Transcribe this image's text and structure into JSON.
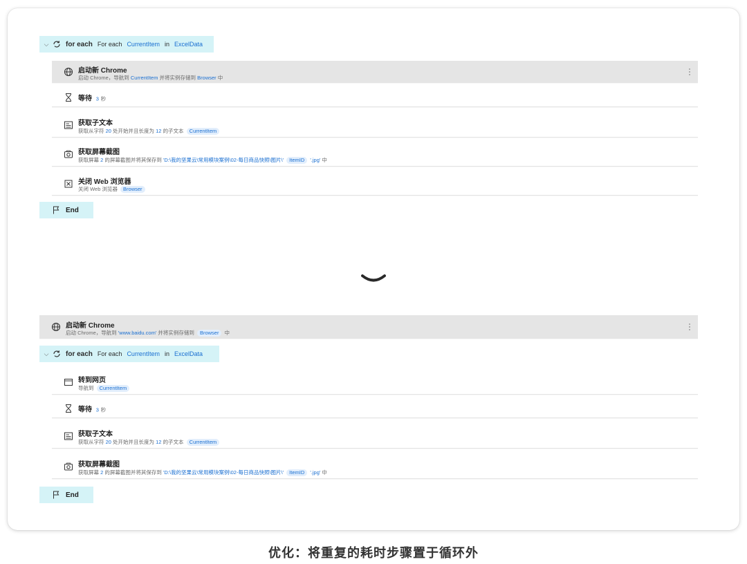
{
  "top": {
    "loop": {
      "keyword": "for each",
      "label": "For each",
      "item_var": "CurrentItem",
      "in_word": "in",
      "source_var": "ExcelData"
    },
    "steps": [
      {
        "icon": "globe-icon",
        "title": "启动新 Chrome",
        "sub_parts": [
          "启动 Chrome，导航到",
          "CurrentItem",
          "并将实例存储到",
          "Browser",
          "中"
        ],
        "highlighted": true
      },
      {
        "icon": "hourglass-icon",
        "title": "等待",
        "value": "3",
        "unit": "秒"
      },
      {
        "icon": "text-doc-icon",
        "title": "获取子文本",
        "sub_parts": [
          "获取从字符",
          "20",
          "处开始并且长度为",
          "12",
          "的子文本",
          "CurrentItem"
        ]
      },
      {
        "icon": "camera-icon",
        "title": "获取屏幕截图",
        "sub_parts": [
          "获取屏幕",
          "2",
          "的屏幕截图并将其保存到",
          "'D:\\我的坚果云\\常用模块案例\\02-每日商品快照\\图片\\'",
          "ItemID",
          "'.jpg'",
          "中"
        ]
      },
      {
        "icon": "close-box-icon",
        "title": "关闭 Web 浏览器",
        "sub_parts": [
          "关闭 Web 浏览器",
          "Browser"
        ]
      }
    ],
    "end_label": "End"
  },
  "bottom": {
    "pre_step": {
      "icon": "globe-icon",
      "title": "启动新 Chrome",
      "sub_parts": [
        "启动 Chrome，导航到",
        "'www.baidu.com'",
        "并将实例存储到",
        "Browser",
        "中"
      ]
    },
    "loop": {
      "keyword": "for each",
      "label": "For each",
      "item_var": "CurrentItem",
      "in_word": "in",
      "source_var": "ExcelData"
    },
    "steps": [
      {
        "icon": "browser-window-icon",
        "title": "转到网页",
        "sub_parts": [
          "导航到",
          "CurrentItem"
        ]
      },
      {
        "icon": "hourglass-icon",
        "title": "等待",
        "value": "3",
        "unit": "秒"
      },
      {
        "icon": "text-doc-icon",
        "title": "获取子文本",
        "sub_parts": [
          "获取从字符",
          "20",
          "处开始并且长度为",
          "12",
          "的子文本",
          "CurrentItem"
        ]
      },
      {
        "icon": "camera-icon",
        "title": "获取屏幕截图",
        "sub_parts": [
          "获取屏幕",
          "2",
          "的屏幕截图并将其保存到",
          "'D:\\我的坚果云\\常用模块案例\\02-每日商品快照\\图片\\'",
          "ItemID",
          "'.jpg'",
          "中"
        ]
      }
    ],
    "end_label": "End"
  },
  "transition_icon": "chevron-down-icon",
  "caption": "优化：将重复的耗时步骤置于循环外",
  "colors": {
    "loop_bg": "#d5f3f7",
    "highlight_bg": "#e5e5e5",
    "token_blue": "#1a6fd1",
    "pill_bg": "#e2eefc"
  }
}
